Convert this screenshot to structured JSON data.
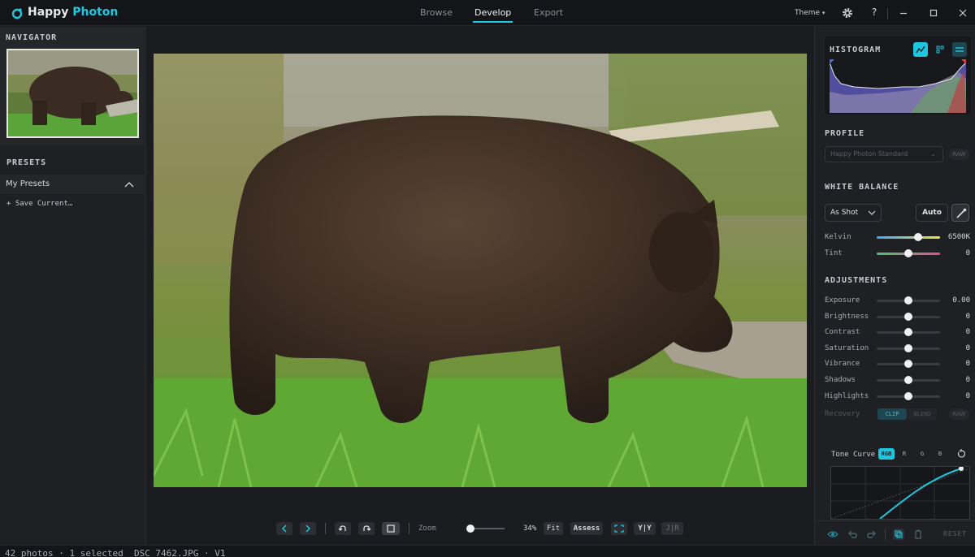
{
  "app": {
    "name_part1": "Happy",
    "name_part2": "Photon",
    "accent": "#1fc6e0"
  },
  "main_tabs": [
    {
      "label": "Browse",
      "active": false
    },
    {
      "label": "Develop",
      "active": true
    },
    {
      "label": "Export",
      "active": false
    }
  ],
  "titlebar": {
    "theme_label": "Theme",
    "help_label": "?"
  },
  "left_panel": {
    "navigator_title": "NAVIGATOR",
    "presets_title": "PRESETS",
    "my_presets_label": "My Presets",
    "save_current_label": "+ Save Current…"
  },
  "bottom_toolbar": {
    "zoom_label": "Zoom",
    "zoom_value": "34%",
    "zoom_level": 0.34,
    "fit_label": "Fit",
    "assess_label": "Assess",
    "compare_label": "Y|Y",
    "split_label": "J|R"
  },
  "right_panel": {
    "histogram_title": "HISTOGRAM",
    "profile_title": "PROFILE",
    "profile_value": "Happy Photon Standard",
    "raw_label": "RAW",
    "white_balance_title": "WHITE BALANCE",
    "wb_preset": "As Shot",
    "auto_label": "Auto",
    "kelvin": {
      "label": "Kelvin",
      "value": "6500K",
      "level": 0.66
    },
    "tint": {
      "label": "Tint",
      "value": "0",
      "level": 0.5
    },
    "adjustments_title": "ADJUSTMENTS",
    "adjustments": [
      {
        "label": "Exposure",
        "value": "0.00",
        "level": 0.5
      },
      {
        "label": "Brightness",
        "value": "0",
        "level": 0.5
      },
      {
        "label": "Contrast",
        "value": "0",
        "level": 0.5
      },
      {
        "label": "Saturation",
        "value": "0",
        "level": 0.5
      },
      {
        "label": "Vibrance",
        "value": "0",
        "level": 0.5
      },
      {
        "label": "Shadows",
        "value": "0",
        "level": 0.5
      },
      {
        "label": "Highlights",
        "value": "0",
        "level": 0.5
      }
    ],
    "recovery_label": "Recovery",
    "clip_label": "CLIP",
    "blend_label": "BLEND",
    "tone_curve_label": "Tone Curve",
    "tone_channels": [
      "RGB",
      "R",
      "G",
      "B"
    ],
    "reset_label": "RESET"
  },
  "status": {
    "text": "42 photos · 1 selected  DSC_7462.JPG · V1"
  }
}
